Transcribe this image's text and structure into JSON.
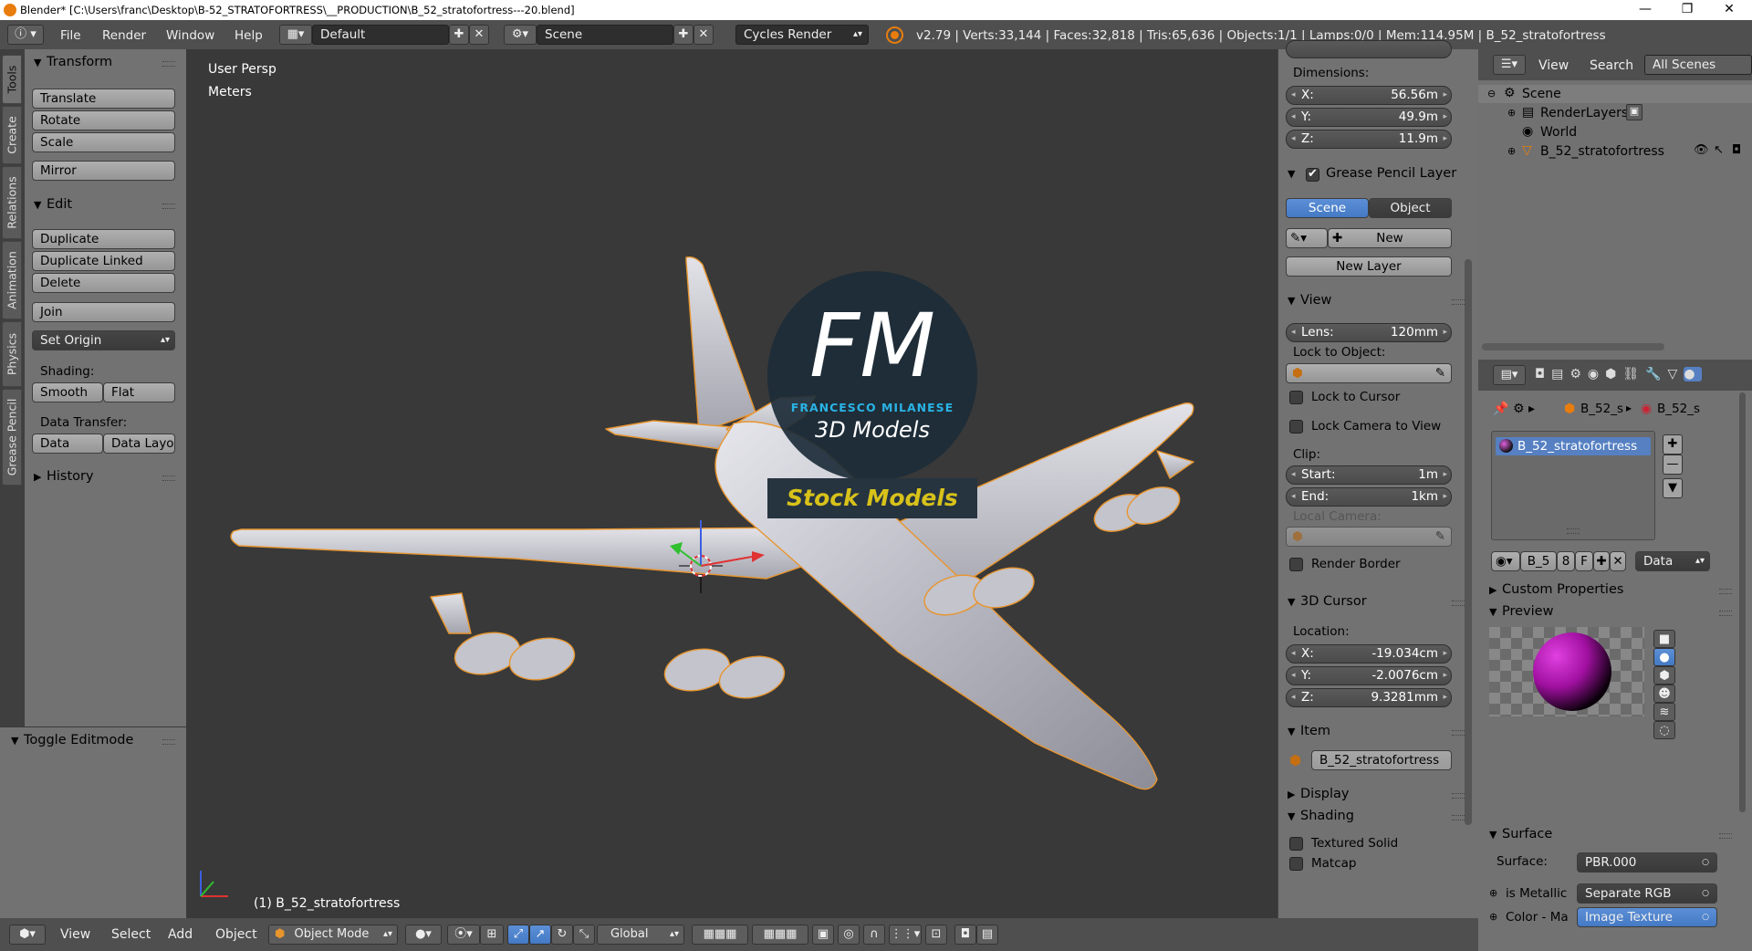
{
  "titlebar": {
    "title": "Blender* [C:\\Users\\franc\\Desktop\\B-52_STRATOFORTRESS\\__PRODUCTION\\B_52_stratofortress---20.blend]",
    "minimize": "—",
    "maximize": "❐",
    "close": "✕"
  },
  "info": {
    "menus": [
      "File",
      "Render",
      "Window",
      "Help"
    ],
    "layout": "Default",
    "scene": "Scene",
    "engine": "Cycles Render",
    "stats": "v2.79 | Verts:33,144 | Faces:32,818 | Tris:65,636 | Objects:1/1 | Lamps:0/0 | Mem:114.95M | B_52_stratofortress"
  },
  "tabs": [
    "Tools",
    "Create",
    "Relations",
    "Animation",
    "Physics",
    "Grease Pencil"
  ],
  "toolshelf": {
    "transform": {
      "header": "Transform",
      "buttons": [
        "Translate",
        "Rotate",
        "Scale",
        "Mirror"
      ]
    },
    "edit": {
      "header": "Edit",
      "buttons": [
        "Duplicate",
        "Duplicate Linked",
        "Delete",
        "Join"
      ],
      "set_origin": "Set Origin",
      "shading_label": "Shading:",
      "shading": [
        "Smooth",
        "Flat"
      ],
      "data_transfer_label": "Data Transfer:",
      "data_transfer": [
        "Data",
        "Data Layo"
      ]
    },
    "history": "History",
    "toggle_editmode": "Toggle Editmode"
  },
  "viewport": {
    "view_name": "User Persp",
    "units": "Meters",
    "object_label": "(1) B_52_stratofortress",
    "watermark": {
      "fm": "FM",
      "name": "FRANCESCO MILANESE",
      "sub": "3D Models",
      "stock": "Stock Models"
    }
  },
  "npanel": {
    "dimensions_label": "Dimensions:",
    "dims": [
      {
        "axis": "X:",
        "value": "56.56m"
      },
      {
        "axis": "Y:",
        "value": "49.9m"
      },
      {
        "axis": "Z:",
        "value": "11.9m"
      }
    ],
    "grease": {
      "header": "Grease Pencil Layer",
      "scene": "Scene",
      "object": "Object",
      "new": "New",
      "new_layer": "New Layer"
    },
    "view": {
      "header": "View",
      "lens_label": "Lens:",
      "lens": "120mm",
      "lock_to_object": "Lock to Object:",
      "lock_to_cursor": "Lock to Cursor",
      "lock_camera": "Lock Camera to View",
      "clip_label": "Clip:",
      "start_label": "Start:",
      "start": "1m",
      "end_label": "End:",
      "end": "1km",
      "local_camera": "Local Camera:",
      "render_border": "Render Border"
    },
    "cursor": {
      "header": "3D Cursor",
      "location": "Location:",
      "coords": [
        {
          "axis": "X:",
          "value": "-19.034cm"
        },
        {
          "axis": "Y:",
          "value": "-2.0076cm"
        },
        {
          "axis": "Z:",
          "value": "9.3281mm"
        }
      ]
    },
    "item": {
      "header": "Item",
      "name": "B_52_stratofortress"
    },
    "display": "Display",
    "shading": {
      "header": "Shading",
      "textured_solid": "Textured Solid",
      "matcap": "Matcap"
    }
  },
  "outliner": {
    "view": "View",
    "search": "Search",
    "filter": "All Scenes",
    "items": [
      "Scene",
      "RenderLayers",
      "World",
      "B_52_stratofortress"
    ]
  },
  "properties": {
    "breadcrumb": [
      "B_52_s",
      "B_52_s"
    ],
    "slot": "B_52_stratofortress",
    "material_name": "B_5",
    "users": "8",
    "fake": "F",
    "data_dropdown": "Data",
    "custom_props": "Custom Properties",
    "preview": "Preview",
    "surface_header": "Surface",
    "surface_label": "Surface:",
    "surface_value": "PBR.000",
    "is_metallic": "is Metallic",
    "is_metallic_value": "Separate RGB",
    "color_label": "Color - Ma",
    "color_value": "Image Texture"
  },
  "bottombar": {
    "menus": [
      "View",
      "Select",
      "Add",
      "Object"
    ],
    "mode": "Object Mode",
    "orientation": "Global"
  },
  "colors": {
    "header": "#4f4f4f",
    "panel": "#727272",
    "viewport": "#393939",
    "selection": "#5680c2",
    "outline": "#e8952e"
  }
}
